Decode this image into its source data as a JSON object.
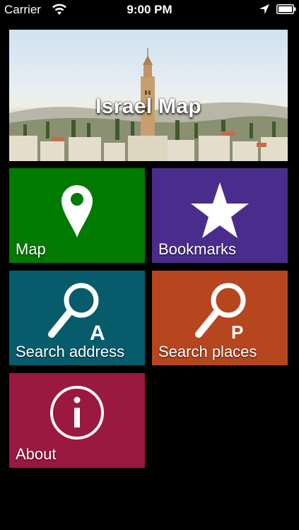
{
  "status_bar": {
    "carrier": "Carrier",
    "time": "9:00 PM",
    "wifi_icon": "wifi-icon",
    "location_icon": "location-arrow-icon",
    "battery_icon": "battery-icon"
  },
  "banner": {
    "title": "Israel Map"
  },
  "tiles": [
    {
      "label": "Map",
      "icon": "map-pin-icon",
      "color": "#007a00"
    },
    {
      "label": "Bookmarks",
      "icon": "star-icon",
      "color": "#4a2c8c"
    },
    {
      "label": "Search address",
      "icon": "search-address-icon",
      "color": "#075c6b",
      "icon_letter": "A"
    },
    {
      "label": "Search places",
      "icon": "search-places-icon",
      "color": "#b5461e",
      "icon_letter": "P"
    },
    {
      "label": "About",
      "icon": "info-icon",
      "color": "#9b1840"
    }
  ]
}
